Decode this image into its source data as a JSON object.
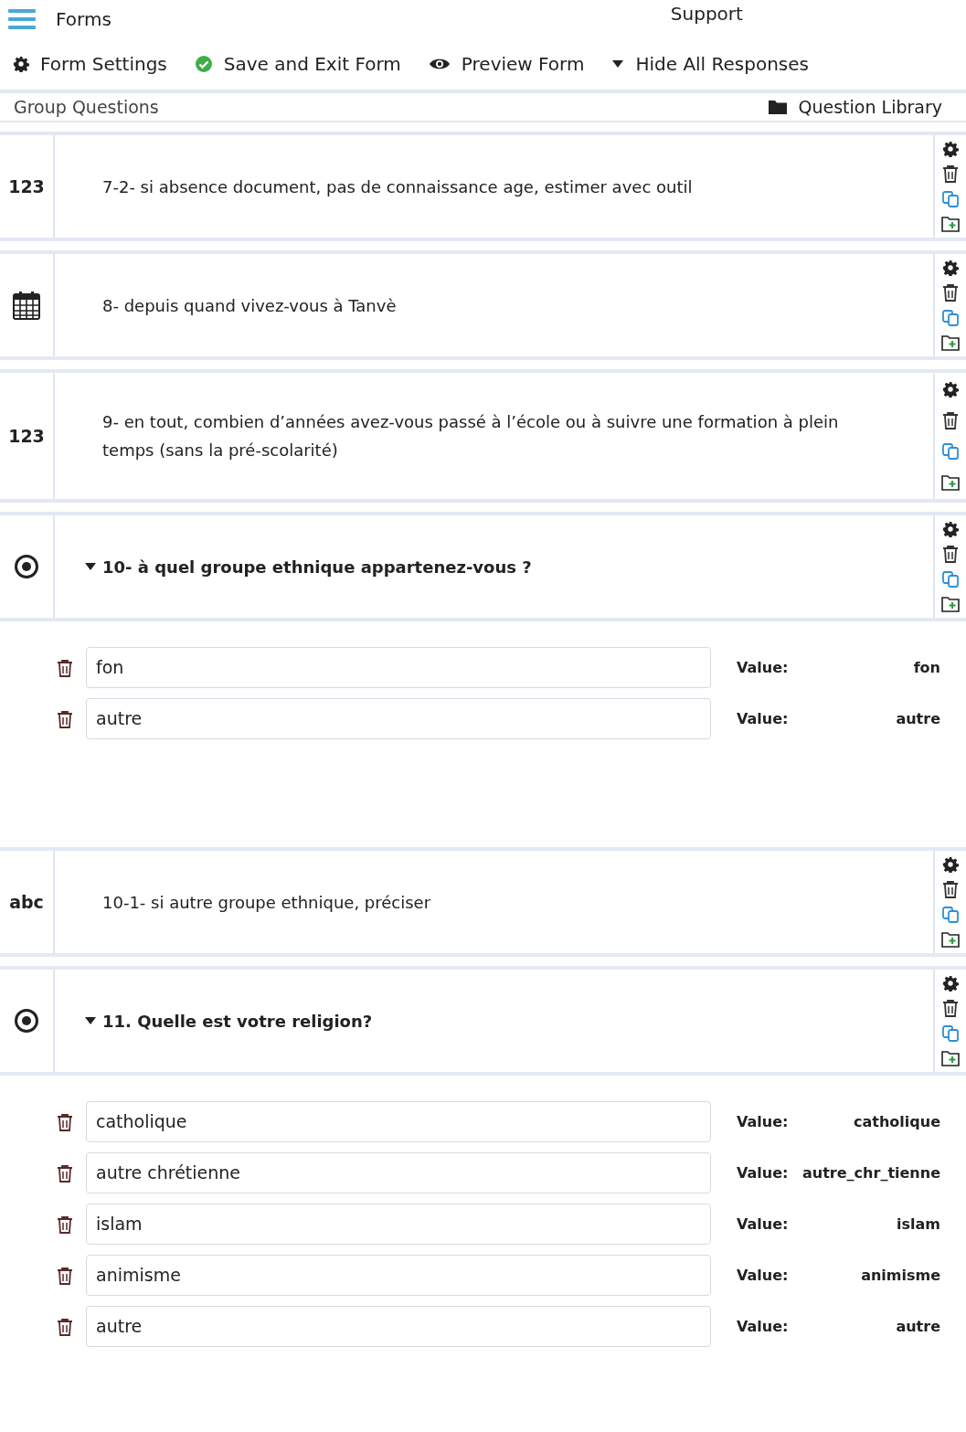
{
  "app_bar": {
    "title": "Forms",
    "support": "Support"
  },
  "toolbar": [
    "Form Settings",
    "Save and Exit Form",
    "Preview Form",
    "Hide All Responses"
  ],
  "group_bar": {
    "title": "Group Questions",
    "library": "Question Library"
  },
  "questions": [
    {
      "kind": "number",
      "type_label": "123",
      "text": "7-2- si absence document, pas de connaissance age, estimer avec outil"
    },
    {
      "kind": "date",
      "text": "8- depuis quand vivez-vous à Tanvè"
    },
    {
      "kind": "number",
      "type_label": "123",
      "text": "9- en tout, combien d’années avez-vous passé à l’école ou à suivre une formation à plein temps (sans la pré-scolarité)"
    },
    {
      "kind": "select",
      "text": "10- à quel groupe ethnique appartenez-vous ?",
      "expanded": true,
      "choices": [
        {
          "label": "fon",
          "value_label": "Value:",
          "value": "fon"
        },
        {
          "label": "autre",
          "value_label": "Value:",
          "value": "autre"
        }
      ]
    },
    {
      "kind": "text",
      "type_label": "abc",
      "text": "10-1- si autre groupe ethnique, préciser"
    },
    {
      "kind": "select",
      "text": "11. Quelle est votre religion?",
      "expanded": true,
      "choices": [
        {
          "label": "catholique",
          "value_label": "Value:",
          "value": "catholique"
        },
        {
          "label": "autre chrétienne",
          "value_label": "Value:",
          "value": "autre_chr_tienne"
        },
        {
          "label": "islam",
          "value_label": "Value:",
          "value": "islam"
        },
        {
          "label": "animisme",
          "value_label": "Value:",
          "value": "animisme"
        },
        {
          "label": "autre",
          "value_label": "Value:",
          "value": "autre"
        }
      ]
    }
  ]
}
